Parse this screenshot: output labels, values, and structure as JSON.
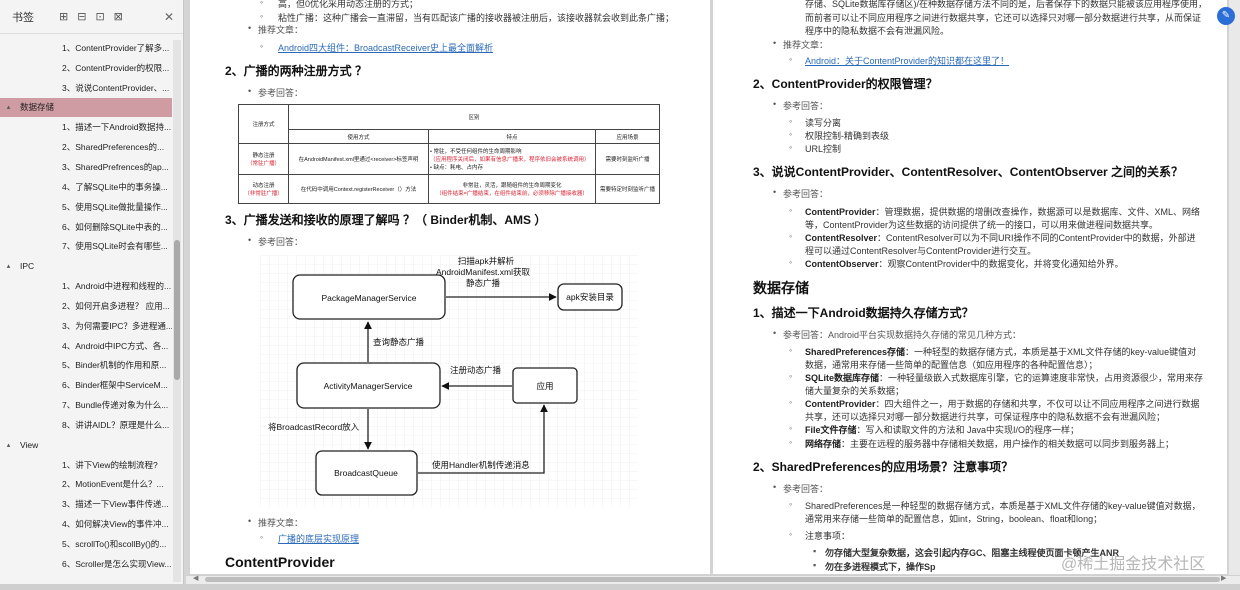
{
  "sidebar": {
    "title": "书签",
    "tools": [
      "⊞",
      "⊟",
      "⊡",
      "⊠"
    ],
    "close": "✕",
    "items": [
      {
        "level": 2,
        "text": "1、ContentProvider了解多...",
        "caret": ""
      },
      {
        "level": 2,
        "text": "2、ContentProvider的权限...",
        "caret": ""
      },
      {
        "level": 2,
        "text": "3、说说ContentProvider、...",
        "caret": ""
      },
      {
        "level": 1,
        "text": "数据存储",
        "caret": "▴",
        "selected": true
      },
      {
        "level": 2,
        "text": "1、描述一下Android数据持...",
        "caret": ""
      },
      {
        "level": 2,
        "text": "2、SharedPreferences的...",
        "caret": ""
      },
      {
        "level": 2,
        "text": "3、SharedPrefrences的ap...",
        "caret": ""
      },
      {
        "level": 2,
        "text": "4、了解SQLite中的事务操...",
        "caret": ""
      },
      {
        "level": 2,
        "text": "5、使用SQLite做批量操作...",
        "caret": ""
      },
      {
        "level": 2,
        "text": "6、如何删除SQLite中表的...",
        "caret": ""
      },
      {
        "level": 2,
        "text": "7、使用SQLite时会有哪些...",
        "caret": ""
      },
      {
        "level": 1,
        "text": "IPC",
        "caret": "▴"
      },
      {
        "level": 2,
        "text": "1、Android中进程和线程的...",
        "caret": ""
      },
      {
        "level": 2,
        "text": "2、如何开启多进程？ 应用...",
        "caret": ""
      },
      {
        "level": 2,
        "text": "3、为何需要IPC？多进程通...",
        "caret": ""
      },
      {
        "level": 2,
        "text": "4、Android中IPC方式、各...",
        "caret": ""
      },
      {
        "level": 2,
        "text": "5、Binder机制的作用和原...",
        "caret": ""
      },
      {
        "level": 2,
        "text": "6、Binder框架中ServiceM...",
        "caret": ""
      },
      {
        "level": 2,
        "text": "7、Bundle传递对象为什么...",
        "caret": ""
      },
      {
        "level": 2,
        "text": "8、讲讲AIDL？原理是什么...",
        "caret": ""
      },
      {
        "level": 1,
        "text": "View",
        "caret": "▴"
      },
      {
        "level": 2,
        "text": "1、讲下View的绘制流程?",
        "caret": ""
      },
      {
        "level": 2,
        "text": "2、MotionEvent是什么？...",
        "caret": ""
      },
      {
        "level": 2,
        "text": "3、描述一下View事件传递...",
        "caret": ""
      },
      {
        "level": 2,
        "text": "4、如何解决View的事件冲...",
        "caret": ""
      },
      {
        "level": 2,
        "text": "5、scrollTo()和scollBy()的...",
        "caret": ""
      },
      {
        "level": 2,
        "text": "6、Scroller是怎么实现View...",
        "caret": ""
      }
    ]
  },
  "left_page": {
    "frag_top1": "高，但0优化采用动态注册的方式；",
    "frag_top2": "粘性广播：这种广播会一直滞留，当有匹配该广播的接收器被注册后，该接收器就会收到此条广播；",
    "rec_label": "推荐文章：",
    "rec_link1": "Android四大组件：BroadcastReceiver史上最全面解析",
    "h_reg": "2、广播的两种注册方式 ？",
    "ref_answer": "参考回答：",
    "table": {
      "h_mode": "注册方式",
      "h_diff": "区别",
      "h_use": "使用方式",
      "h_feat": "特点",
      "h_scene": "应用场景",
      "r1_mode": "静态注册",
      "r1_mode_note": "（常驻广播）",
      "r1_use": "在AndroidManifest.xml里通过<receiver>标签声明",
      "r1_feat1": "• 常驻，不受任何组件的生命周期影响",
      "r1_feat1_note": "（应用程序关闭后，如果有信息广播来，程序依旧会被系统调用）",
      "r1_feat2": "• 缺点：耗电、占内存",
      "r1_scene": "需要时刻监听广播",
      "r2_mode": "动态注册",
      "r2_mode_note": "（非常驻广播）",
      "r2_use": "在代码中调用Context.registerReceiver（）方法",
      "r2_feat1": "非常驻，灵活，跟随组件的生命周期变化",
      "r2_feat1_note": "（组件结束=广播结束，在组件结束前，必须移除广播接收器）",
      "r2_scene": "需要特定时刻监听广播"
    },
    "h_send": "3、广播发送和接收的原理了解吗 ？（ Binder机制、AMS ）",
    "diagram": {
      "pms": "PackageManagerService",
      "apk": "apk安装目录",
      "ams": "ActivityManagerService",
      "app": "应用",
      "queue": "BroadcastQueue",
      "scan1": "扫描apk并解析",
      "scan2": "AndroidManifest.xml获取",
      "scan3": "静态广播",
      "query": "查询静态广播",
      "reg_dyn": "注册动态广播",
      "add_record": "将BroadcastRecord放入",
      "handler": "使用Handler机制传递消息"
    },
    "rec_link2": "广播的底层实现原理",
    "h_cp": "ContentProvider"
  },
  "right_page": {
    "frag1": "存储、SQLite数据库存储区)/在种数据存储方法不同的是，后者保存下的数据只能被该应用程序使用，",
    "frag2": "而前者可以让不同应用程序之间进行数据共享，它还可以选择只对哪一部分数据进行共享，从而保证",
    "frag3": "程序中的隐私数据不会有泄漏风险。",
    "rec_label": "推荐文章：",
    "rec_link": "Android：关于ContentProvider的知识都在这里了！",
    "h_perm": "2、ContentProvider的权限管理？",
    "ref_answer": "参考回答：",
    "perm_items": [
      "读写分离",
      "权限控制-精确到表级",
      "URL控制"
    ],
    "h_rel": "3、说说ContentProvider、ContentResolver、ContentObserver 之间的关系？",
    "rel": [
      {
        "k": "ContentProvider",
        "v1": "：管理数据，提供数据的增删改查操作，数据源可以是数据库、文件、XML、网络",
        "v2": "等，ContentProvider为这些数据的访问提供了统一的接口，可以用来做进程间数据共享。"
      },
      {
        "k": "ContentResolver",
        "v1": "：ContentResolver可以为不同URI操作不同的ContentProvider中的数据，外部进",
        "v2": "程可以通过ContentResolver与ContentProvider进行交互。"
      },
      {
        "k": "ContentObserver",
        "v1": "：观察ContentProvider中的数据变化，并将变化通知给外界。",
        "v2": ""
      }
    ],
    "h_storage": "数据存储",
    "h_persist": "1、描述一下Android数据持久存储方式？",
    "ref_persist": "参考回答：Android平台实现数据持久存储的常见几种方式：",
    "persist": [
      {
        "k": "SharedPreferences存储",
        "v1": "：一种轻型的数据存储方式，本质是基于XML文件存储的key-value键值对",
        "v2": "数据，通常用来存储一些简单的配置信息（如应用程序的各种配置信息）；"
      },
      {
        "k": "SQLite数据库存储",
        "v1": "：一种轻量级嵌入式数据库引擎，它的运算速度非常快，占用资源很少，常用来存",
        "v2": "储大量复杂的关系数据；"
      },
      {
        "k": "ContentProvider",
        "v1": "：四大组件之一，用于数据的存储和共享，不仅可以让不同应用程序之间进行数据",
        "v2": "共享，还可以选择只对哪一部分数据进行共享，可保证程序中的隐私数据不会有泄漏风险；"
      },
      {
        "k": "File文件存储",
        "v1": "：写入和读取文件的方法和 Java中实现I/O的程序一样；",
        "v2": ""
      },
      {
        "k": "网络存储",
        "v1": "：主要在远程的服务器中存储相关数据，用户操作的相关数据可以同步到服务器上；",
        "v2": ""
      }
    ],
    "h_sp": "2、SharedPreferences的应用场景？注意事项？",
    "sp_ref": "参考回答：",
    "sp_desc1": "SharedPreferences是一种轻型的数据存储方式，本质是基于XML文件存储的key-value键值对数据，",
    "sp_desc2": "通常用来存储一些简单的配置信息，如int，String，boolean、float和long；",
    "sp_note": "注意事项：",
    "sp_n1": "勿存储大型复杂数据，这会引起内存GC、阻塞主线程使页面卡顿产生ANR",
    "sp_n2": "勿在多进程模式下，操作Sp"
  },
  "watermark": "@稀土掘金技术社区",
  "ext_badge": "✎"
}
